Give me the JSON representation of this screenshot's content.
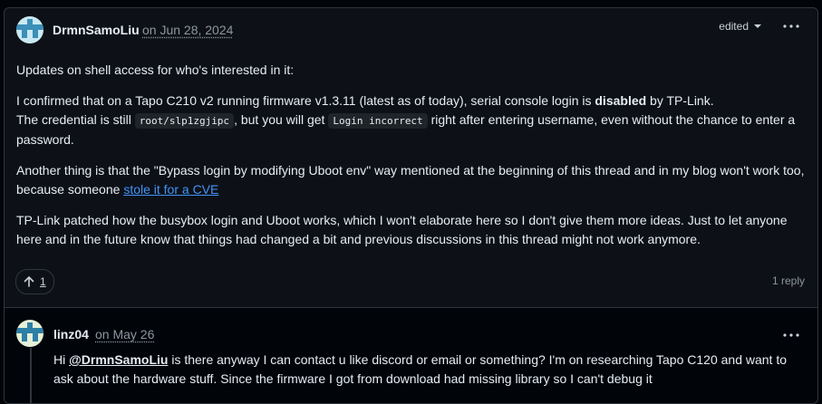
{
  "comment": {
    "author": "DrmnSamoLiu",
    "date": "on Jun 28, 2024",
    "edited_label": "edited",
    "paragraphs": {
      "p1": "Updates on shell access for who's interested in it:",
      "p2a": "I confirmed that on a Tapo C210 v2 running firmware v1.3.11 (latest as of today), serial console login is ",
      "p2b": "disabled",
      "p2c": " by TP-Link.",
      "p3a": "The credential is still ",
      "p3code1": "root/slp1zgjipc",
      "p3b": ", but you will get ",
      "p3code2": "Login incorrect",
      "p3c": " right after entering username, even without the chance to enter a password.",
      "p4a": "Another thing is that the \"Bypass login by modifying Uboot env\" way mentioned at the beginning of this thread and in my blog won't work too, because someone ",
      "p4link": "stole it for a CVE",
      "p5": "TP-Link patched how the busybox login and Uboot works, which I won't elaborate here so I don't give them more ideas. Just to let anyone here and in the future know that things had changed a bit and previous discussions in this thread might not work anymore."
    },
    "reaction": {
      "icon": "arrow-up-icon",
      "count": "1"
    },
    "reply_count": "1 reply"
  },
  "reply": {
    "author": "linz04",
    "date": "on May 26",
    "text_a": "Hi ",
    "mention": "@DrmnSamoLiu",
    "text_b": " is there anyway I can contact u like discord or email or something? I'm on researching Tapo C120 and want to ask about the hardware stuff. Since the firmware I got from download had missing library so I can't debug it"
  },
  "colors": {
    "background": "#0d1117",
    "link": "#4493f8",
    "muted": "#8d96a0",
    "border": "#30363d"
  }
}
